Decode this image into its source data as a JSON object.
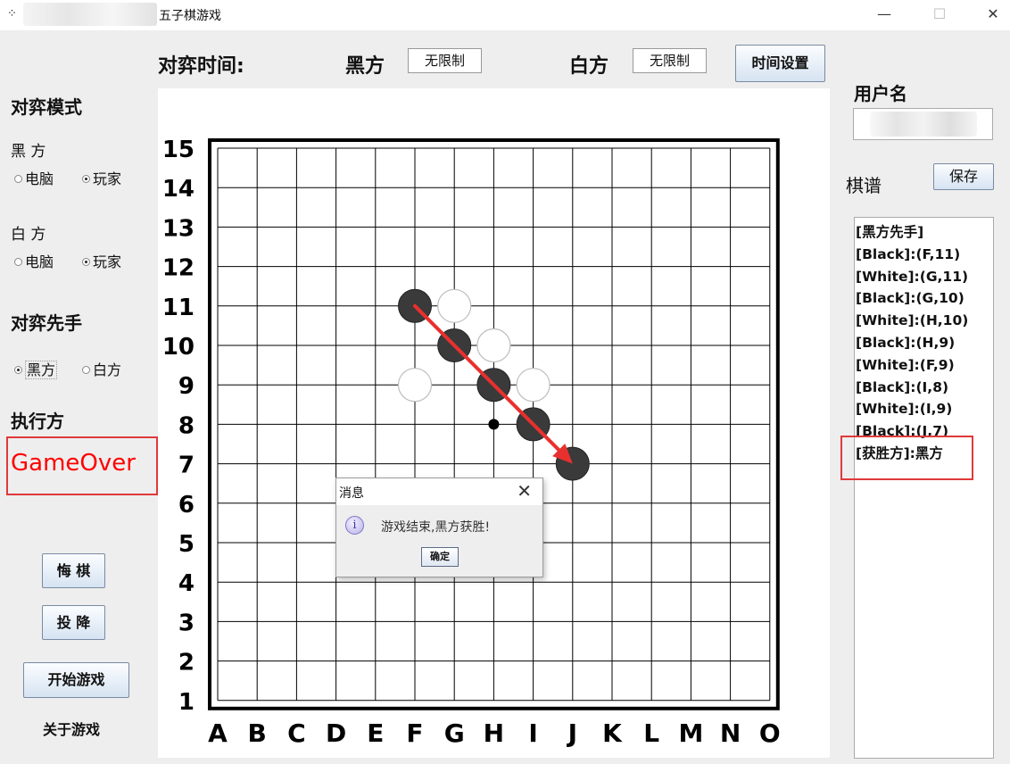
{
  "window": {
    "title": "五子棋游戏",
    "min_glyph": "—",
    "max_glyph": "☐",
    "close_glyph": "✕"
  },
  "header": {
    "time_label": "对弈时间:",
    "black_label": "黑方",
    "black_time": "无限制",
    "white_label": "白方",
    "white_time": "无限制",
    "time_settings_button": "时间设置"
  },
  "left_panel": {
    "mode_title": "对弈模式",
    "black_label": "黑 方",
    "black_options": [
      "电脑",
      "玩家"
    ],
    "black_selected": "玩家",
    "white_label": "白 方",
    "white_options": [
      "电脑",
      "玩家"
    ],
    "white_selected": "玩家",
    "first_title": "对弈先手",
    "first_options": [
      "黑方",
      "白方"
    ],
    "first_selected": "黑方",
    "turn_title": "执行方",
    "turn_value": "GameOver",
    "undo_button": "悔 棋",
    "surrender_button": "投 降",
    "start_button": "开始游戏",
    "about_link": "关于游戏"
  },
  "right_panel": {
    "username_label": "用户名",
    "record_label": "棋谱",
    "save_button": "保存",
    "record_lines": [
      "[黑方先手]",
      "[Black]:(F,11)",
      "[White]:(G,11)",
      "[Black]:(G,10)",
      "[White]:(H,10)",
      "[Black]:(H,9)",
      "[White]:(F,9)",
      "[Black]:(I,8)",
      "[White]:(I,9)",
      "[Black]:(J,7)",
      "[获胜方]:黑方"
    ]
  },
  "board": {
    "size": 15,
    "columns": [
      "A",
      "B",
      "C",
      "D",
      "E",
      "F",
      "G",
      "H",
      "I",
      "J",
      "K",
      "L",
      "M",
      "N",
      "O"
    ],
    "rows": [
      "15",
      "14",
      "13",
      "12",
      "11",
      "10",
      "9",
      "8",
      "7",
      "6",
      "5",
      "4",
      "3",
      "2",
      "1"
    ],
    "stones": [
      {
        "col": "F",
        "row": 11,
        "color": "black"
      },
      {
        "col": "G",
        "row": 11,
        "color": "white"
      },
      {
        "col": "G",
        "row": 10,
        "color": "black"
      },
      {
        "col": "H",
        "row": 10,
        "color": "white"
      },
      {
        "col": "H",
        "row": 9,
        "color": "black"
      },
      {
        "col": "F",
        "row": 9,
        "color": "white"
      },
      {
        "col": "I",
        "row": 8,
        "color": "black"
      },
      {
        "col": "I",
        "row": 9,
        "color": "white"
      },
      {
        "col": "J",
        "row": 7,
        "color": "black"
      }
    ],
    "star_point": {
      "col": "H",
      "row": 8
    },
    "win_line": {
      "from": {
        "col": "F",
        "row": 11
      },
      "to": {
        "col": "J",
        "row": 7
      }
    },
    "win_line_color": "#e8302e"
  },
  "dialog": {
    "title": "消息",
    "close_glyph": "✕",
    "icon_glyph": "i",
    "message": "游戏结束,黑方获胜!",
    "ok_button": "确定"
  },
  "colors": {
    "accent_red": "#e0393b",
    "gameover_text": "#ff0000"
  }
}
